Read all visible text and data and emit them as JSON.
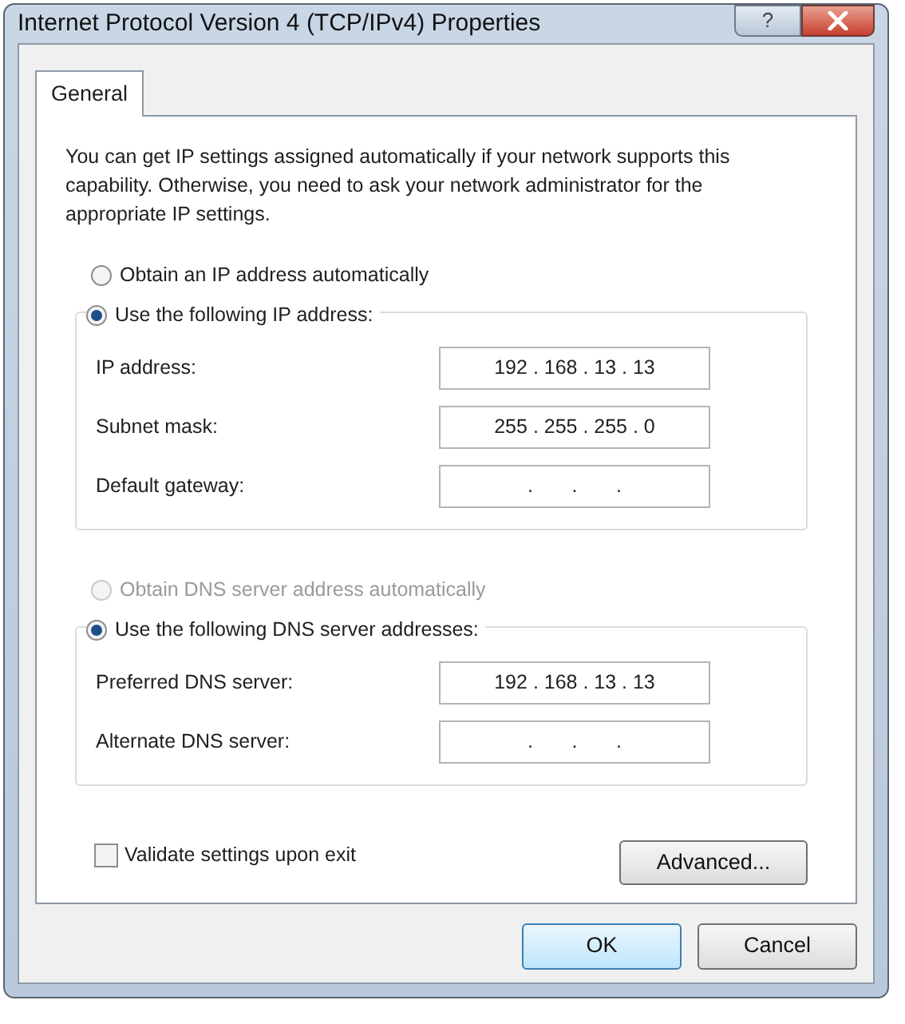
{
  "window": {
    "title": "Internet Protocol Version 4 (TCP/IPv4) Properties",
    "help_button": "?"
  },
  "tabs": [
    {
      "label": "General",
      "selected": true
    }
  ],
  "description": "You can get IP settings assigned automatically if your network supports this capability. Otherwise, you need to ask your network administrator for the appropriate IP settings.",
  "groups": [
    {
      "options": [
        {
          "label": "Obtain an IP address automatically",
          "selected": false,
          "disabled": false
        },
        {
          "label": "Use the following IP address:",
          "selected": true,
          "disabled": false
        }
      ],
      "fields": [
        {
          "label": "IP address:",
          "value": "192 . 168 . 13 . 13"
        },
        {
          "label": "Subnet mask:",
          "value": "255 . 255 . 255 . 0"
        },
        {
          "label": "Default gateway:",
          "value": ".       .       ."
        }
      ]
    },
    {
      "options": [
        {
          "label": "Obtain DNS server address automatically",
          "selected": false,
          "disabled": true
        },
        {
          "label": "Use the following DNS server addresses:",
          "selected": true,
          "disabled": false
        }
      ],
      "fields": [
        {
          "label": "Preferred DNS server:",
          "value": "192 . 168 . 13 . 13"
        },
        {
          "label": "Alternate DNS server:",
          "value": ".       .       ."
        }
      ]
    }
  ],
  "validate": {
    "label": "Validate settings upon exit",
    "checked": false
  },
  "advanced_button": "Advanced...",
  "buttons": [
    {
      "label": "OK",
      "default": true
    },
    {
      "label": "Cancel",
      "default": false
    }
  ]
}
